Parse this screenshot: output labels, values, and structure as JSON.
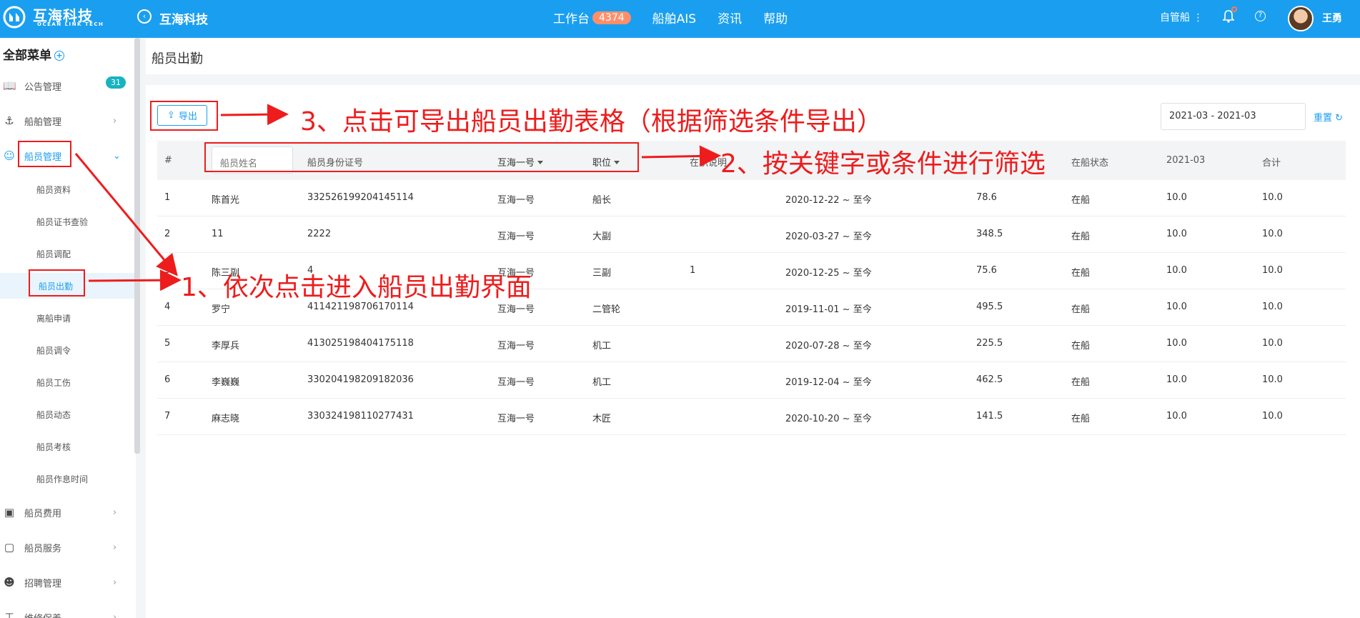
{
  "topbar": {
    "brand": "互海科技",
    "brand_sub": "OCEAN LINK TECH",
    "crumb": "互海科技",
    "nav": [
      {
        "label": "工作台",
        "badge": "4374"
      },
      {
        "label": "船舶AIS"
      },
      {
        "label": "资讯"
      },
      {
        "label": "帮助"
      }
    ],
    "ship_switch": "自管船 ⋮",
    "user_name": "王勇",
    "accent": "#1a9ff0"
  },
  "sidebar": {
    "header": "全部菜单",
    "items": [
      {
        "label": "公告管理",
        "icon": "book-icon",
        "count": "31"
      },
      {
        "label": "船舶管理",
        "icon": "anchor-icon"
      },
      {
        "label": "船员管理",
        "icon": "user-icon",
        "open": true
      },
      {
        "label": "船员费用",
        "icon": "wallet-icon"
      },
      {
        "label": "船员服务",
        "icon": "monitor-icon"
      },
      {
        "label": "招聘管理",
        "icon": "user-search-icon"
      },
      {
        "label": "维修保养",
        "icon": "tool-icon"
      }
    ],
    "sub_items": [
      "船员资料",
      "船员证书查验",
      "船员调配",
      "船员出勤",
      "离船申请",
      "船员调令",
      "船员工伤",
      "船员动态",
      "船员考核",
      "船员作息时间"
    ],
    "active_sub": "船员出勤"
  },
  "page": {
    "title": "船员出勤",
    "export_label": "导出",
    "date_range": "2021-03 - 2021-03",
    "reset_label": "重置"
  },
  "table": {
    "headers": {
      "index": "#",
      "name_placeholder": "船员姓名",
      "id_number": "船员身份证号",
      "ship": "互海一号",
      "position": "职位",
      "note": "在职说明",
      "status": "在船状态",
      "month": "2021-03",
      "total": "合计"
    },
    "rows": [
      [
        "1",
        "陈首光",
        "332526199204145114",
        "互海一号",
        "船长",
        "",
        "2020-12-22 ~ 至今",
        "78.6",
        "在船",
        "10.0",
        "10.0"
      ],
      [
        "2",
        "11",
        "2222",
        "互海一号",
        "大副",
        "",
        "2020-03-27 ~ 至今",
        "348.5",
        "在船",
        "10.0",
        "10.0"
      ],
      [
        "3",
        "陈三副",
        "4",
        "互海一号",
        "三副",
        "1",
        "2020-12-25 ~ 至今",
        "75.6",
        "在船",
        "10.0",
        "10.0"
      ],
      [
        "4",
        "罗宁",
        "411421198706170114",
        "互海一号",
        "二管轮",
        "",
        "2019-11-01 ~ 至今",
        "495.5",
        "在船",
        "10.0",
        "10.0"
      ],
      [
        "5",
        "李厚兵",
        "413025198404175118",
        "互海一号",
        "机工",
        "",
        "2020-07-28 ~ 至今",
        "225.5",
        "在船",
        "10.0",
        "10.0"
      ],
      [
        "6",
        "李巍巍",
        "330204198209182036",
        "互海一号",
        "机工",
        "",
        "2019-12-04 ~ 至今",
        "462.5",
        "在船",
        "10.0",
        "10.0"
      ],
      [
        "7",
        "麻志晓",
        "330324198110277431",
        "互海一号",
        "木匠",
        "",
        "2020-10-20 ~ 至今",
        "141.5",
        "在船",
        "10.0",
        "10.0"
      ]
    ]
  },
  "annotations": {
    "step1": "1、依次点击进入船员出勤界面",
    "step2": "2、按关键字或条件进行筛选",
    "step3": "3、点击可导出船员出勤表格（根据筛选条件导出）",
    "color": "#ee1c1c"
  }
}
